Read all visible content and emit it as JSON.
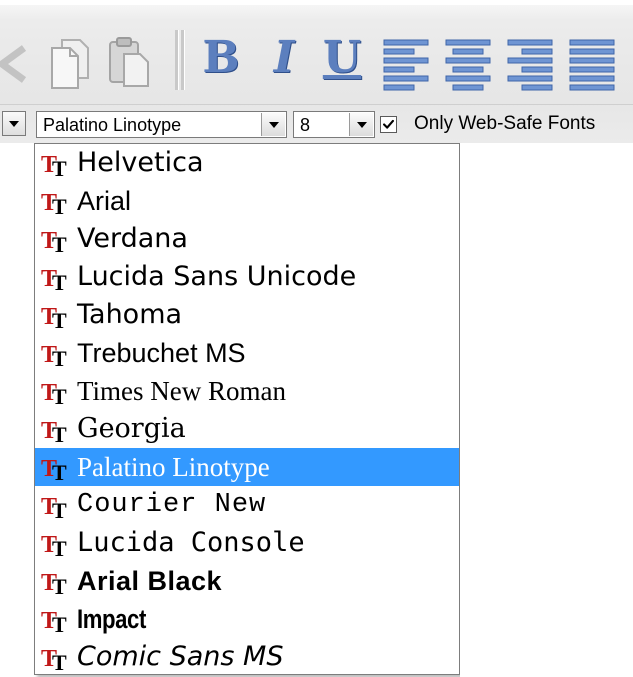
{
  "toolbar": {
    "buttons": [
      {
        "name": "undo-icon"
      },
      {
        "name": "copy-icon"
      },
      {
        "name": "paste-icon"
      },
      {
        "name": "bold",
        "label": "B"
      },
      {
        "name": "italic",
        "label": "I"
      },
      {
        "name": "underline",
        "label": "U"
      },
      {
        "name": "align-left-icon"
      },
      {
        "name": "align-center-icon"
      },
      {
        "name": "align-right-icon"
      },
      {
        "name": "align-justify-icon"
      }
    ],
    "accent_color": "#5c7fbe"
  },
  "font_select": {
    "value": "Palatino Linotype"
  },
  "size_select": {
    "value": "8"
  },
  "web_safe": {
    "label": "Only Web-Safe Fonts",
    "checked": true
  },
  "font_list": {
    "icon": "truetype-font-icon",
    "selected_index": 8,
    "selection_color": "#3399ff",
    "items": [
      {
        "label": "Helvetica"
      },
      {
        "label": "Arial"
      },
      {
        "label": "Verdana"
      },
      {
        "label": "Lucida Sans Unicode"
      },
      {
        "label": "Tahoma"
      },
      {
        "label": "Trebuchet MS"
      },
      {
        "label": "Times New Roman"
      },
      {
        "label": "Georgia"
      },
      {
        "label": "Palatino Linotype"
      },
      {
        "label": "Courier New"
      },
      {
        "label": "Lucida Console"
      },
      {
        "label": "Arial Black"
      },
      {
        "label": "Impact"
      },
      {
        "label": "Comic Sans MS"
      }
    ]
  }
}
